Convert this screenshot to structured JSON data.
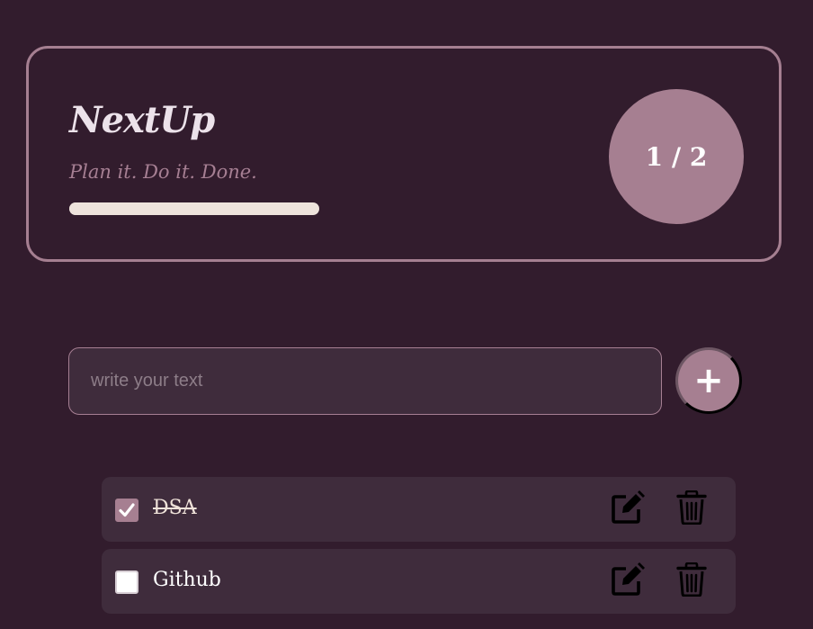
{
  "header": {
    "title": "NextUp",
    "tagline": "Plan it. Do it. Done.",
    "progress": 0.5,
    "counter": "1 / 2"
  },
  "composer": {
    "placeholder": "write your text",
    "value": "",
    "add_label": "+"
  },
  "todos": [
    {
      "text": "DSA",
      "completed": true
    },
    {
      "text": "Github",
      "completed": false
    }
  ],
  "icons": {
    "edit": "edit-icon",
    "delete": "trash-icon",
    "check": "check-icon"
  },
  "colors": {
    "background": "#321c2d",
    "card": "#3f2c3c",
    "accent": "#a67f91",
    "progress": "#eee3dc",
    "text": "#ffffff"
  }
}
